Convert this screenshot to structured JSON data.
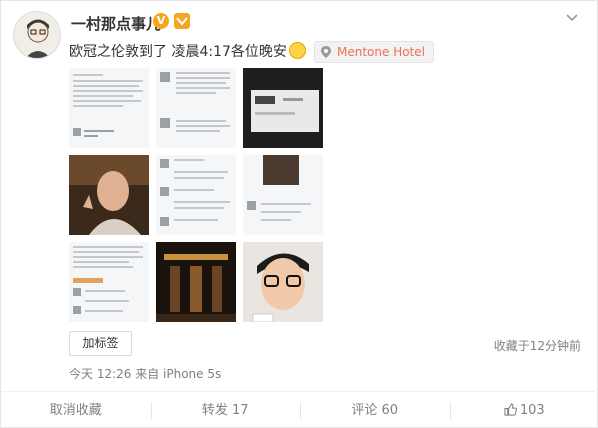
{
  "post": {
    "username": "一村那点事儿",
    "text": "欧冠之伦敦到了 凌晨4:17各位晚安",
    "location": "Mentone Hotel",
    "tag_button": "加标签",
    "favorited": "收藏于12分钟前",
    "meta": "今天 12:26 来自 iPhone 5s"
  },
  "actions": {
    "unfavorite": "取消收藏",
    "repost": "转发 17",
    "comment": "评论 60",
    "like": "103"
  },
  "images": [
    {
      "name": "photo-1-chat-screenshot"
    },
    {
      "name": "photo-2-chat-screenshot"
    },
    {
      "name": "photo-3-screen-photo"
    },
    {
      "name": "photo-4-man-portrait"
    },
    {
      "name": "photo-5-chat-screenshot"
    },
    {
      "name": "photo-6-chat-screenshot"
    },
    {
      "name": "photo-7-chat-screenshot"
    },
    {
      "name": "photo-8-building-night"
    },
    {
      "name": "photo-9-glasses-portrait"
    }
  ],
  "colors": {
    "accent": "#eb7350",
    "muted": "#808080",
    "verify": "#f7a51c"
  }
}
